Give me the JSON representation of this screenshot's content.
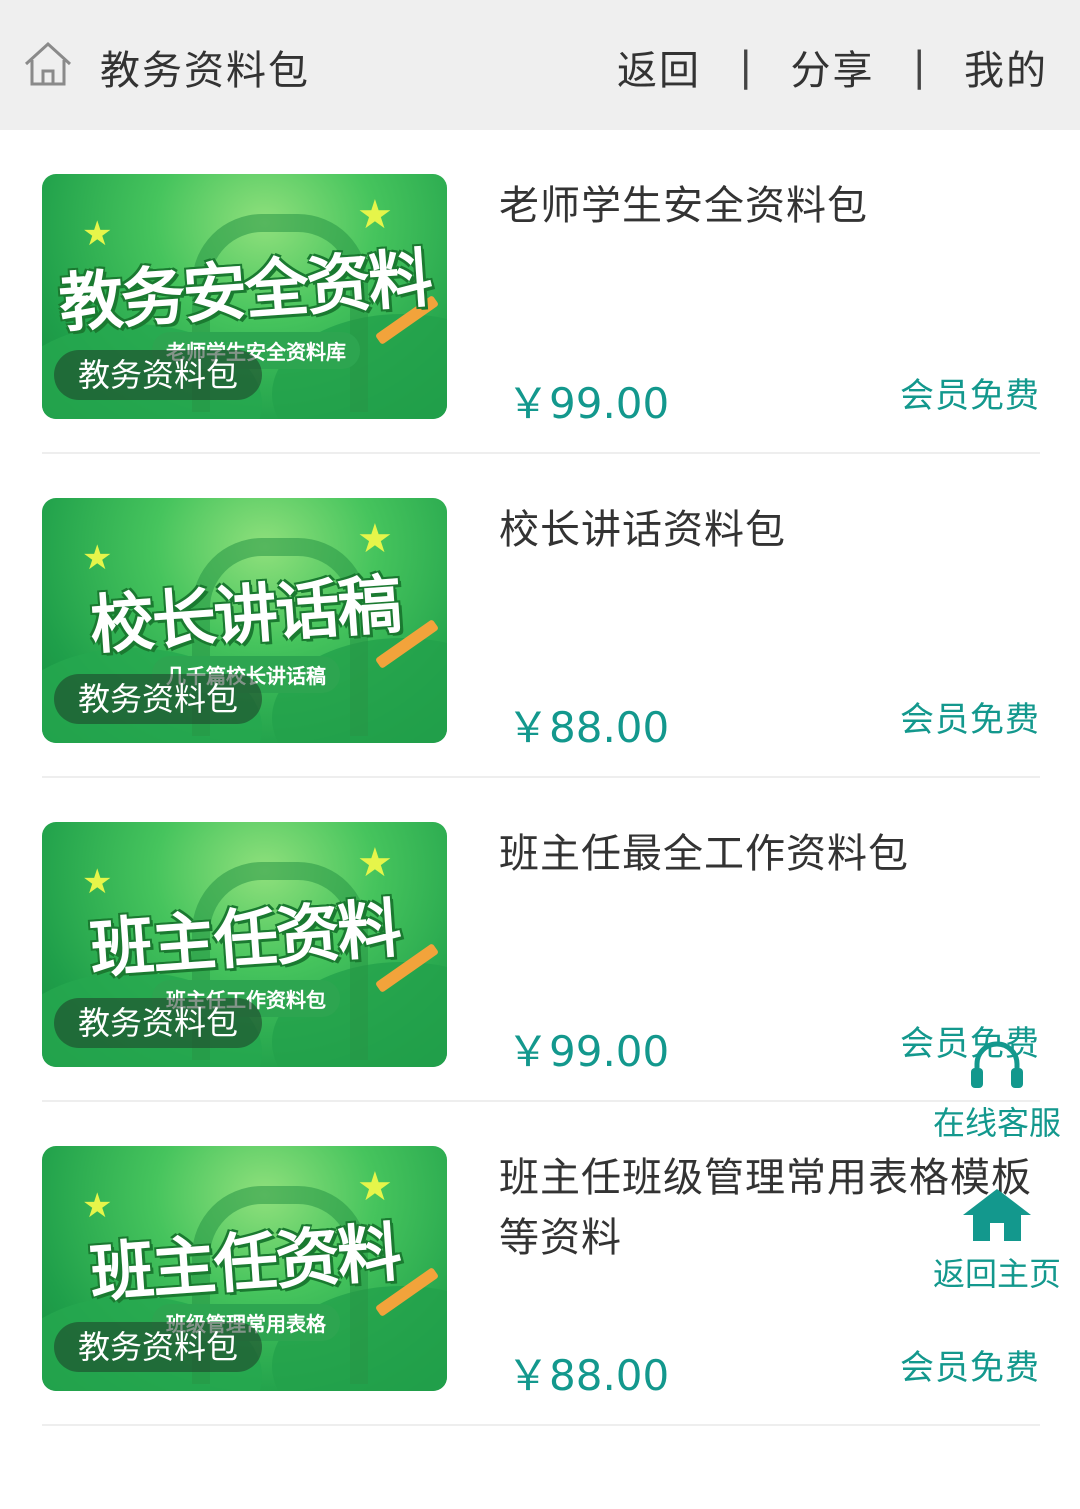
{
  "header": {
    "site_title": "教务资料包",
    "icon": "home-outline-icon",
    "nav": {
      "back": "返回",
      "sep1": "|",
      "share": "分享",
      "sep2": "|",
      "mine": "我的"
    }
  },
  "items": [
    {
      "thumb_big": "教务安全资料",
      "thumb_sub": "老师学生安全资料库",
      "thumb_tag": "教务资料包",
      "title": "老师学生安全资料包",
      "price": "￥99.00",
      "member": "会员免费"
    },
    {
      "thumb_big": "校长讲话稿",
      "thumb_sub": "几千篇校长讲话稿",
      "thumb_tag": "教务资料包",
      "title": "校长讲话资料包",
      "price": "￥88.00",
      "member": "会员免费"
    },
    {
      "thumb_big": "班主任资料",
      "thumb_sub": "班主任工作资料包",
      "thumb_tag": "教务资料包",
      "title": "班主任最全工作资料包",
      "price": "￥99.00",
      "member": "会员免费"
    },
    {
      "thumb_big": "班主任资料",
      "thumb_sub": "班级管理常用表格",
      "thumb_tag": "教务资料包",
      "title": "班主任班级管理常用表格模板等资料",
      "price": "￥88.00",
      "member": "会员免费"
    }
  ],
  "floating": {
    "customer_service": {
      "label": "在线客服",
      "icon": "headset-icon"
    },
    "home": {
      "label": "返回主页",
      "icon": "home-icon"
    }
  },
  "colors": {
    "accent": "#13988d",
    "header_bg": "#efefef",
    "thumb_green": "#2da550"
  }
}
